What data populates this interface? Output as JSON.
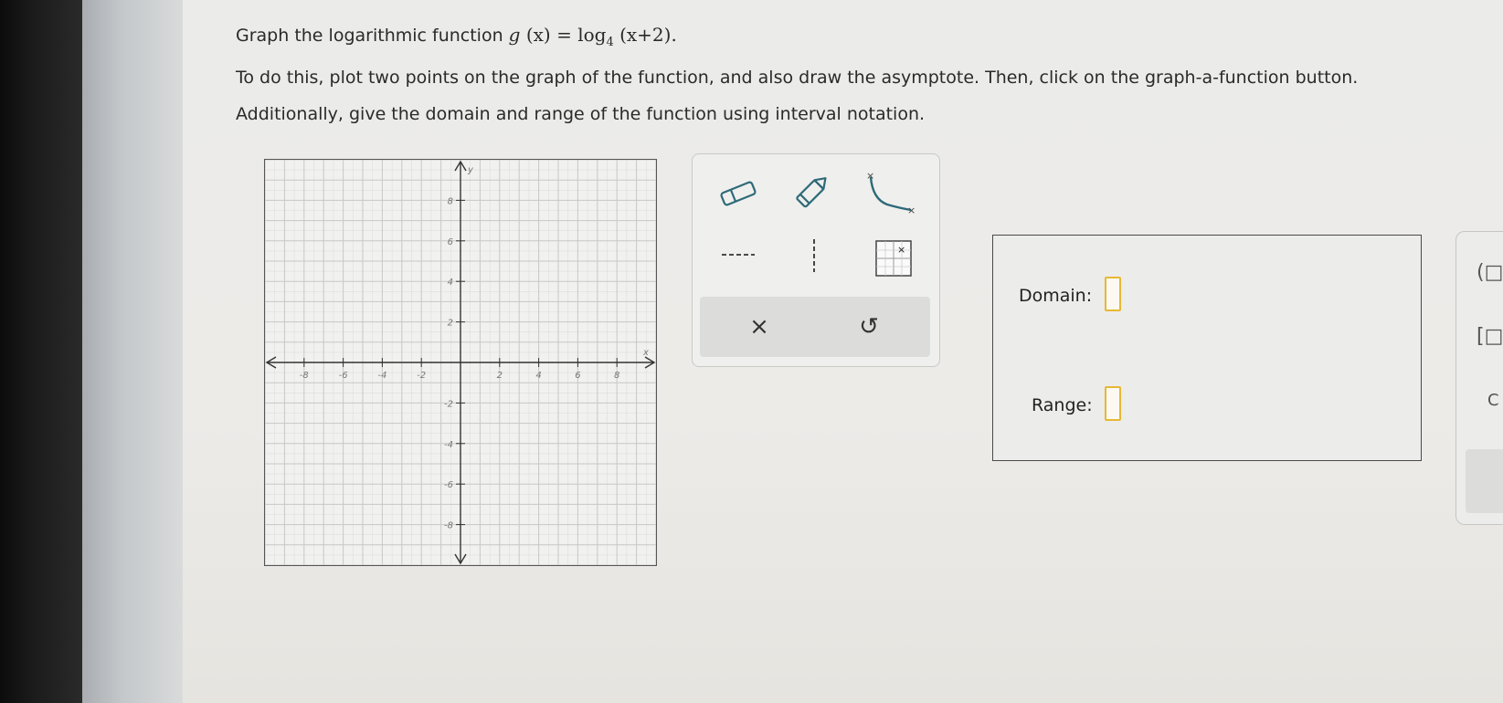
{
  "problem": {
    "line1_prefix": "Graph the logarithmic function ",
    "func_name": "g",
    "func_var": "(x)",
    "equals": " = log",
    "log_base": "4",
    "func_arg": "(x+2).",
    "line2": "To do this, plot two points on the graph of the function, and also draw the asymptote. Then, click on the graph-a-function button.",
    "line3": "Additionally, give the domain and range of the function using interval notation."
  },
  "graph": {
    "x_axis_label": "x",
    "y_axis_label": "y",
    "x_range": [
      -10,
      10
    ],
    "y_range": [
      -10,
      10
    ],
    "x_tick_labels": [
      "-8",
      "-6",
      "-4",
      "-2",
      "2",
      "4",
      "6",
      "8"
    ],
    "y_tick_labels": [
      "8",
      "6",
      "4",
      "2",
      "-2",
      "-4",
      "-6",
      "-8"
    ]
  },
  "tools": {
    "eraser_icon": "eraser-icon",
    "pencil_icon": "pencil-icon",
    "curve_icon": "log-curve-icon",
    "horizontal_asymptote_icon": "horizontal-dashed-line-icon",
    "vertical_asymptote_icon": "vertical-dashed-line-icon",
    "point_grid_icon": "grid-point-icon",
    "clear_label": "×",
    "undo_label": "↺"
  },
  "answers": {
    "domain_label": "Domain:",
    "domain_value": "",
    "range_label": "Range:",
    "range_value": ""
  },
  "side_palette": {
    "open_paren_label": "(□",
    "open_bracket_label": "[□",
    "partial_label": "C"
  },
  "colors": {
    "answer_box_border": "#e8b833",
    "tool_teal": "#2e6a78"
  }
}
